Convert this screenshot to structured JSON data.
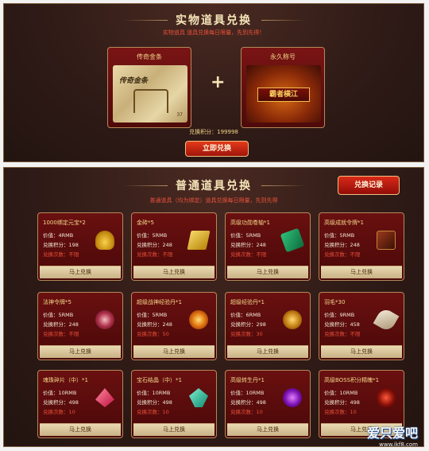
{
  "physical": {
    "title": "实物道具兑换",
    "subtitle": "实物道具 道具兑换每日限量，先到先得！",
    "prize_left": {
      "label": "传奇金条",
      "art_text": "传奇金条",
      "art_num": "37"
    },
    "prize_right": {
      "label": "永久称号",
      "art_text": "霸者横江"
    },
    "plus": "+",
    "points": "兑换积分：199998",
    "redeem_label": "立即兑换"
  },
  "normal": {
    "title": "普通道具兑换",
    "subtitle": "普通道具（均为绑定）道具兑换每日限量，先到先得",
    "record_label": "兑换记录",
    "items": [
      {
        "name": "1000绑定元宝*2",
        "price": "价值：4RMB",
        "points": "兑换积分：198",
        "limit": "兑换次数：不限",
        "button": "马上兑换",
        "icon": "gold-ingot-icon"
      },
      {
        "name": "金砖*5",
        "price": "价值：5RMB",
        "points": "兑换积分：248",
        "limit": "兑换次数：不限",
        "button": "马上兑换",
        "icon": "gold-brick-icon"
      },
      {
        "name": "高级功勋卷轴*1",
        "price": "价值：5RMB",
        "points": "兑换积分：248",
        "limit": "兑换次数：不限",
        "button": "马上兑换",
        "icon": "scroll-icon"
      },
      {
        "name": "高级成就令牌*1",
        "price": "价值：5RMB",
        "points": "兑换积分：248",
        "limit": "兑换次数：不限",
        "button": "马上兑换",
        "icon": "token-icon"
      },
      {
        "name": "法神令牌*5",
        "price": "价值：5RMB",
        "points": "兑换积分：248",
        "limit": "兑换次数：不限",
        "button": "马上兑换",
        "icon": "mage-token-icon"
      },
      {
        "name": "超级战神经验丹*1",
        "price": "价值：5RMB",
        "points": "兑换积分：248",
        "limit": "兑换次数：50",
        "button": "马上兑换",
        "icon": "exp-pill-icon"
      },
      {
        "name": "超级经验丹*1",
        "price": "价值：6RMB",
        "points": "兑换积分：298",
        "limit": "兑换次数：30",
        "button": "马上兑换",
        "icon": "exp-orb-icon"
      },
      {
        "name": "羽毛*30",
        "price": "价值：9RMB",
        "points": "兑换积分：458",
        "limit": "兑换次数：不限",
        "button": "马上兑换",
        "icon": "feather-icon"
      },
      {
        "name": "魂珠碎片（中）*1",
        "price": "价值：10RMB",
        "points": "兑换积分：498",
        "limit": "兑换次数：10",
        "button": "马上兑换",
        "icon": "soul-shard-icon"
      },
      {
        "name": "宝石结晶（中）*1",
        "price": "价值：10RMB",
        "points": "兑换积分：498",
        "limit": "兑换次数：10",
        "button": "马上兑换",
        "icon": "gem-crystal-icon"
      },
      {
        "name": "高级转生丹*1",
        "price": "价值：10RMB",
        "points": "兑换积分：498",
        "limit": "兑换次数：10",
        "button": "马上兑换",
        "icon": "rebirth-pill-icon"
      },
      {
        "name": "高级BOSS积分精魄*1",
        "price": "价值：10RMB",
        "points": "兑换积分：498",
        "limit": "兑换次数：10",
        "button": "马上兑换",
        "icon": "boss-essence-icon"
      }
    ]
  },
  "watermark": {
    "brand": "爱只爱吧",
    "url": "www.ikf8.com"
  },
  "colors": {
    "accent_red": "#e8503a",
    "gold_text": "#f3d78a",
    "panel_bg": "#2e1a16"
  }
}
